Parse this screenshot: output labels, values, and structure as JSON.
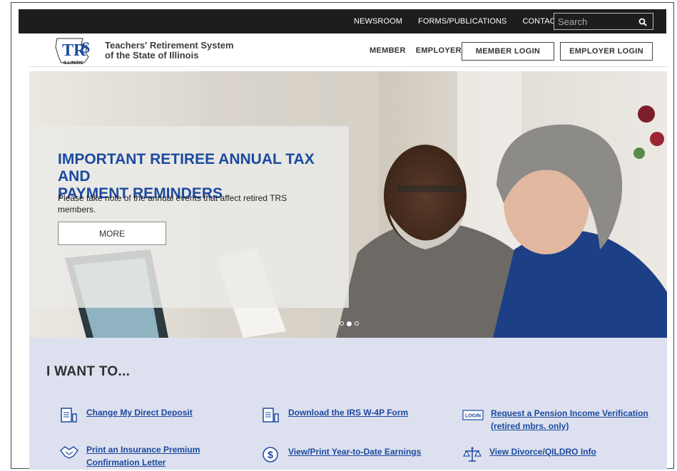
{
  "top_nav": {
    "links": [
      "NEWSROOM",
      "FORMS/PUBLICATIONS",
      "CONTACT"
    ],
    "search_placeholder": "Search"
  },
  "header": {
    "logo_text": "TRS",
    "logo_sub": "ILLINOIS",
    "org_line1": "Teachers' Retirement System",
    "org_line2": "of the State of Illinois",
    "nav": [
      "MEMBER",
      "EMPLOYER"
    ],
    "member_login": "MEMBER LOGIN",
    "employer_login": "EMPLOYER LOGIN"
  },
  "hero": {
    "title_line1": "IMPORTANT RETIREE ANNUAL TAX AND",
    "title_line2": "PAYMENT REMINDERS",
    "body": "Please take note of the annual events that affect retired TRS members.",
    "button": "MORE",
    "slide_count": 3,
    "active_slide": 2
  },
  "i_want_to": {
    "heading": "I WANT TO...",
    "items": [
      {
        "label": "Change My Direct Deposit",
        "icon": "document-icon"
      },
      {
        "label": "Download the IRS W-4P Form",
        "icon": "document-icon"
      },
      {
        "label": "Request a Pension Income Verification",
        "label2": "(retired mbrs. only)",
        "icon": "login-icon",
        "icon_text": "LOGIN"
      },
      {
        "label": "Print an Insurance Premium",
        "label2": "Confirmation Letter",
        "icon": "handshake-icon"
      },
      {
        "label": "View/Print Year-to-Date Earnings",
        "icon": "dollar-icon"
      },
      {
        "label": "View Divorce/QILDRO Info",
        "icon": "scales-icon"
      }
    ]
  },
  "colors": {
    "accent_blue": "#1b4aa0",
    "top_bar": "#1d1d1d",
    "section_bg": "#dde0ee"
  }
}
